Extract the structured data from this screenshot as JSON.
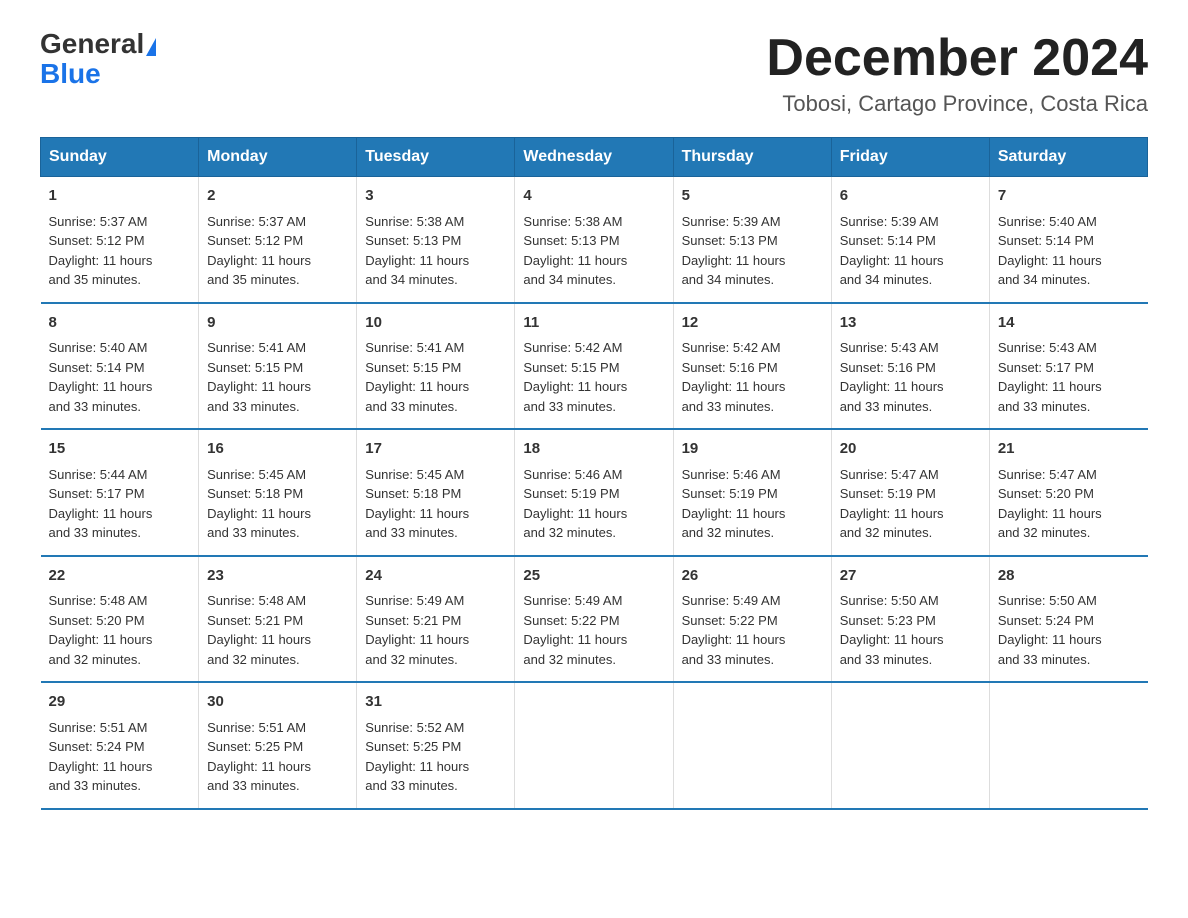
{
  "header": {
    "logo_general": "General",
    "logo_blue": "Blue",
    "month_year": "December 2024",
    "location": "Tobosi, Cartago Province, Costa Rica"
  },
  "days_of_week": [
    "Sunday",
    "Monday",
    "Tuesday",
    "Wednesday",
    "Thursday",
    "Friday",
    "Saturday"
  ],
  "weeks": [
    [
      {
        "day": "1",
        "sunrise": "5:37 AM",
        "sunset": "5:12 PM",
        "daylight": "11 hours and 35 minutes."
      },
      {
        "day": "2",
        "sunrise": "5:37 AM",
        "sunset": "5:12 PM",
        "daylight": "11 hours and 35 minutes."
      },
      {
        "day": "3",
        "sunrise": "5:38 AM",
        "sunset": "5:13 PM",
        "daylight": "11 hours and 34 minutes."
      },
      {
        "day": "4",
        "sunrise": "5:38 AM",
        "sunset": "5:13 PM",
        "daylight": "11 hours and 34 minutes."
      },
      {
        "day": "5",
        "sunrise": "5:39 AM",
        "sunset": "5:13 PM",
        "daylight": "11 hours and 34 minutes."
      },
      {
        "day": "6",
        "sunrise": "5:39 AM",
        "sunset": "5:14 PM",
        "daylight": "11 hours and 34 minutes."
      },
      {
        "day": "7",
        "sunrise": "5:40 AM",
        "sunset": "5:14 PM",
        "daylight": "11 hours and 34 minutes."
      }
    ],
    [
      {
        "day": "8",
        "sunrise": "5:40 AM",
        "sunset": "5:14 PM",
        "daylight": "11 hours and 33 minutes."
      },
      {
        "day": "9",
        "sunrise": "5:41 AM",
        "sunset": "5:15 PM",
        "daylight": "11 hours and 33 minutes."
      },
      {
        "day": "10",
        "sunrise": "5:41 AM",
        "sunset": "5:15 PM",
        "daylight": "11 hours and 33 minutes."
      },
      {
        "day": "11",
        "sunrise": "5:42 AM",
        "sunset": "5:15 PM",
        "daylight": "11 hours and 33 minutes."
      },
      {
        "day": "12",
        "sunrise": "5:42 AM",
        "sunset": "5:16 PM",
        "daylight": "11 hours and 33 minutes."
      },
      {
        "day": "13",
        "sunrise": "5:43 AM",
        "sunset": "5:16 PM",
        "daylight": "11 hours and 33 minutes."
      },
      {
        "day": "14",
        "sunrise": "5:43 AM",
        "sunset": "5:17 PM",
        "daylight": "11 hours and 33 minutes."
      }
    ],
    [
      {
        "day": "15",
        "sunrise": "5:44 AM",
        "sunset": "5:17 PM",
        "daylight": "11 hours and 33 minutes."
      },
      {
        "day": "16",
        "sunrise": "5:45 AM",
        "sunset": "5:18 PM",
        "daylight": "11 hours and 33 minutes."
      },
      {
        "day": "17",
        "sunrise": "5:45 AM",
        "sunset": "5:18 PM",
        "daylight": "11 hours and 33 minutes."
      },
      {
        "day": "18",
        "sunrise": "5:46 AM",
        "sunset": "5:19 PM",
        "daylight": "11 hours and 32 minutes."
      },
      {
        "day": "19",
        "sunrise": "5:46 AM",
        "sunset": "5:19 PM",
        "daylight": "11 hours and 32 minutes."
      },
      {
        "day": "20",
        "sunrise": "5:47 AM",
        "sunset": "5:19 PM",
        "daylight": "11 hours and 32 minutes."
      },
      {
        "day": "21",
        "sunrise": "5:47 AM",
        "sunset": "5:20 PM",
        "daylight": "11 hours and 32 minutes."
      }
    ],
    [
      {
        "day": "22",
        "sunrise": "5:48 AM",
        "sunset": "5:20 PM",
        "daylight": "11 hours and 32 minutes."
      },
      {
        "day": "23",
        "sunrise": "5:48 AM",
        "sunset": "5:21 PM",
        "daylight": "11 hours and 32 minutes."
      },
      {
        "day": "24",
        "sunrise": "5:49 AM",
        "sunset": "5:21 PM",
        "daylight": "11 hours and 32 minutes."
      },
      {
        "day": "25",
        "sunrise": "5:49 AM",
        "sunset": "5:22 PM",
        "daylight": "11 hours and 32 minutes."
      },
      {
        "day": "26",
        "sunrise": "5:49 AM",
        "sunset": "5:22 PM",
        "daylight": "11 hours and 33 minutes."
      },
      {
        "day": "27",
        "sunrise": "5:50 AM",
        "sunset": "5:23 PM",
        "daylight": "11 hours and 33 minutes."
      },
      {
        "day": "28",
        "sunrise": "5:50 AM",
        "sunset": "5:24 PM",
        "daylight": "11 hours and 33 minutes."
      }
    ],
    [
      {
        "day": "29",
        "sunrise": "5:51 AM",
        "sunset": "5:24 PM",
        "daylight": "11 hours and 33 minutes."
      },
      {
        "day": "30",
        "sunrise": "5:51 AM",
        "sunset": "5:25 PM",
        "daylight": "11 hours and 33 minutes."
      },
      {
        "day": "31",
        "sunrise": "5:52 AM",
        "sunset": "5:25 PM",
        "daylight": "11 hours and 33 minutes."
      },
      null,
      null,
      null,
      null
    ]
  ],
  "labels": {
    "sunrise": "Sunrise:",
    "sunset": "Sunset:",
    "daylight": "Daylight:"
  }
}
